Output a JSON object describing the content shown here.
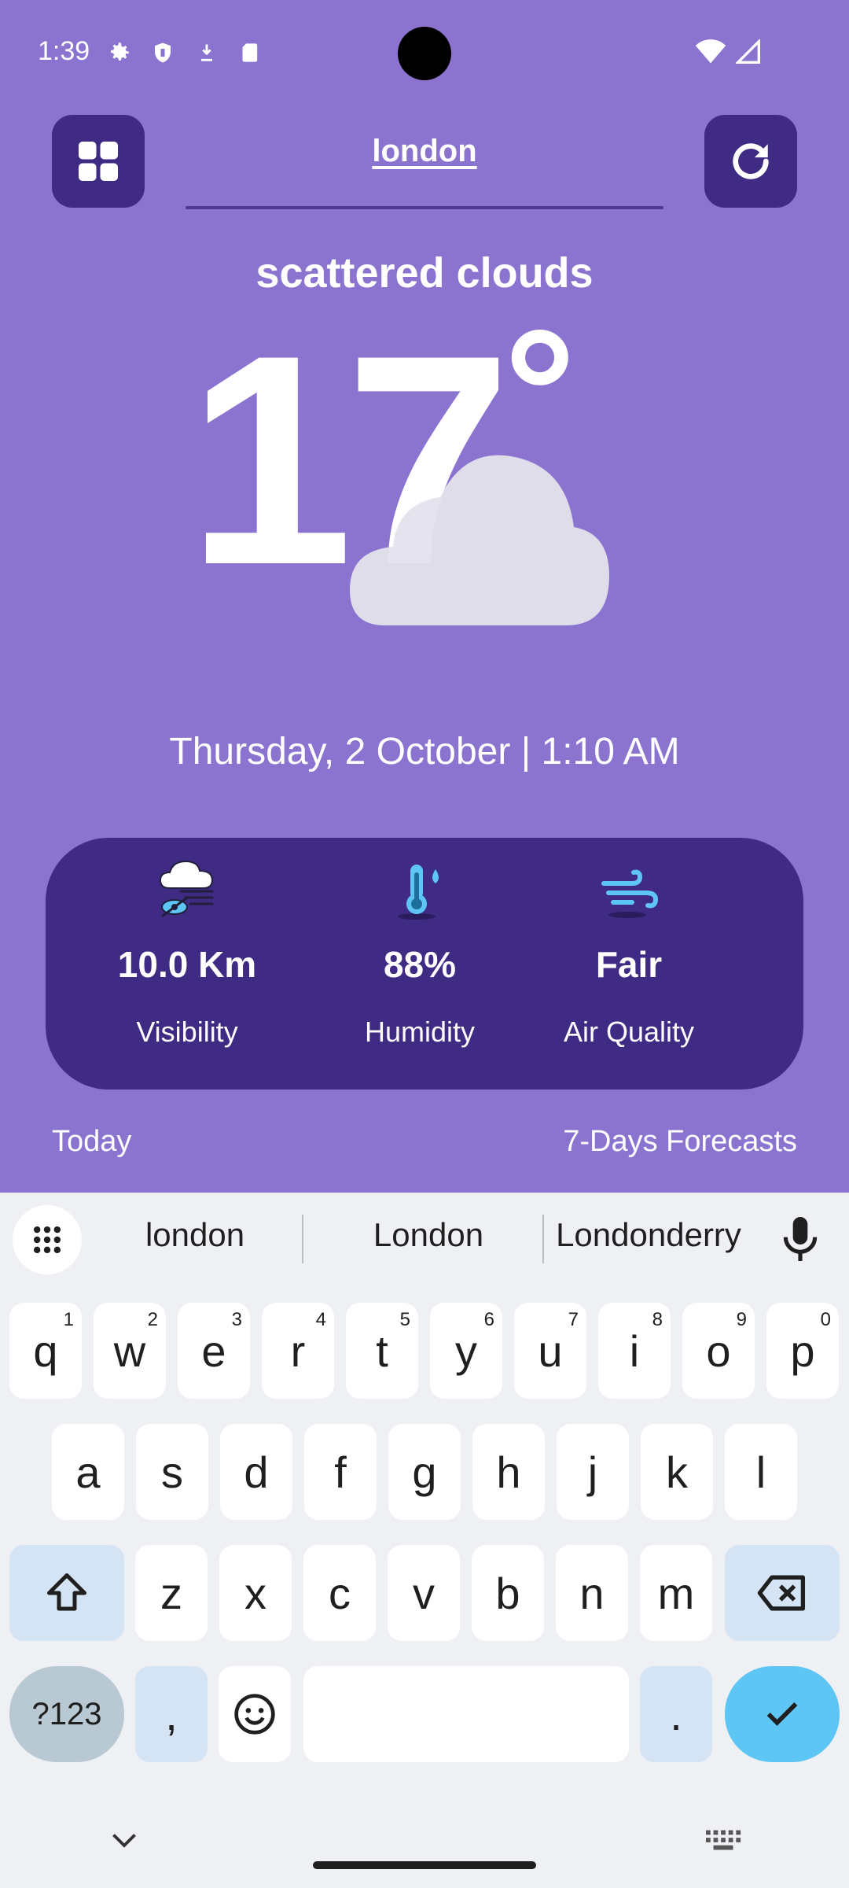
{
  "status_bar": {
    "time": "1:39",
    "icons": [
      "settings-icon",
      "shield-icon",
      "download-icon",
      "sd-card-icon"
    ],
    "right_icons": [
      "wifi-icon",
      "cell-signal-icon"
    ]
  },
  "header": {
    "menu_icon": "grid-icon",
    "search_value": "london",
    "refresh_icon": "refresh-icon"
  },
  "weather": {
    "condition": "scattered clouds",
    "temperature": "17",
    "degree_symbol": "°",
    "icon": "cloud-icon",
    "datetime": "Thursday, 2 October | 1:10 AM"
  },
  "stats": [
    {
      "icon": "visibility-icon",
      "value": "10.0 Km",
      "label": "Visibility"
    },
    {
      "icon": "thermometer-icon",
      "value": "88%",
      "label": "Humidity"
    },
    {
      "icon": "wind-icon",
      "value": "Fair",
      "label": "Air Quality"
    }
  ],
  "tabs": {
    "today": "Today",
    "forecast": "7-Days Forecasts"
  },
  "keyboard": {
    "suggestions": [
      "london",
      "London",
      "Londonderry"
    ],
    "row1": [
      {
        "k": "q",
        "n": "1"
      },
      {
        "k": "w",
        "n": "2"
      },
      {
        "k": "e",
        "n": "3"
      },
      {
        "k": "r",
        "n": "4"
      },
      {
        "k": "t",
        "n": "5"
      },
      {
        "k": "y",
        "n": "6"
      },
      {
        "k": "u",
        "n": "7"
      },
      {
        "k": "i",
        "n": "8"
      },
      {
        "k": "o",
        "n": "9"
      },
      {
        "k": "p",
        "n": "0"
      }
    ],
    "row2": [
      "a",
      "s",
      "d",
      "f",
      "g",
      "h",
      "j",
      "k",
      "l"
    ],
    "row3": [
      "z",
      "x",
      "c",
      "v",
      "b",
      "n",
      "m"
    ],
    "symbols_label": "?123",
    "comma": ",",
    "period": "."
  },
  "colors": {
    "background": "#8a74d0",
    "card": "#3f2a84",
    "accent": "#5ec6f5"
  }
}
